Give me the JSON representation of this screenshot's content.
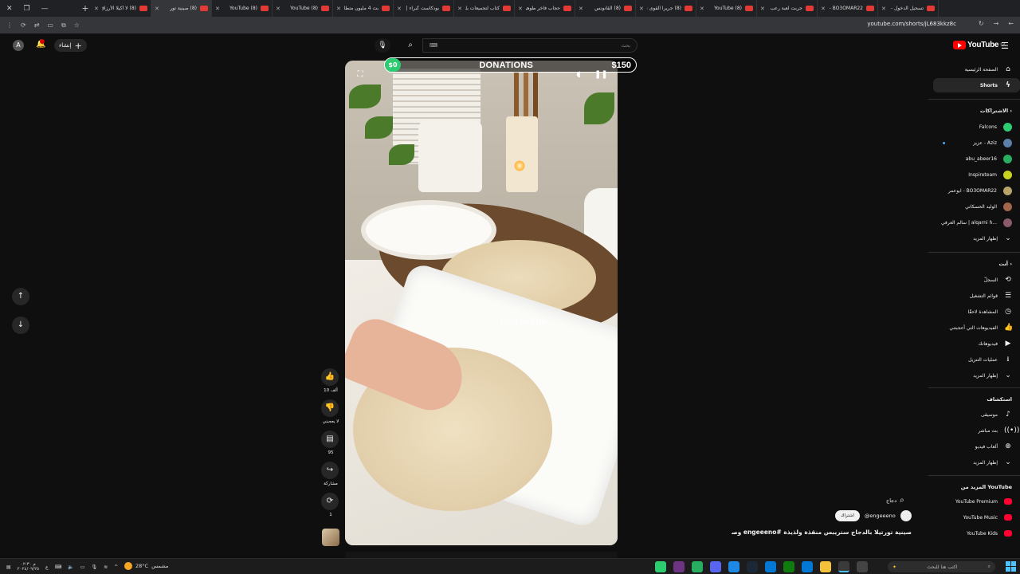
{
  "browser": {
    "tabs": [
      {
        "title": "(8) لا أكيلا الأرزاق جا",
        "active": false
      },
      {
        "title": "(8) صينية تور",
        "active": true
      },
      {
        "title": "(8) YouTube",
        "active": false
      },
      {
        "title": "(8) YouTube",
        "active": false
      },
      {
        "title": "بث 4 مليون متطا",
        "active": false
      },
      {
        "title": "بودكاست كُبراء |",
        "active": false
      },
      {
        "title": "كتاب لتجميعات بلد",
        "active": false
      },
      {
        "title": "حجاب فاخر طوهر",
        "active": false
      },
      {
        "title": "(8) القانونس",
        "active": false
      },
      {
        "title": "(8) جريرا القوى نادر",
        "active": false
      },
      {
        "title": "(8) YouTube",
        "active": false
      },
      {
        "title": "جربت لعبة رعب ...",
        "active": false
      },
      {
        "title": "BO3OMAR22 -",
        "active": false
      },
      {
        "title": "تسجيل الدخول -",
        "active": false
      }
    ],
    "url": "youtube.com/shorts/jL683kkz8c"
  },
  "topbar": {
    "avatar_letter": "A",
    "create_label": "إنشاء",
    "search_placeholder": "بحث",
    "keyboard_icon_label": "⌨",
    "logo_text": "YouTube",
    "logo_country": "SA"
  },
  "sidebar": {
    "home": "الصفحة الرئيسية",
    "shorts": "Shorts",
    "subscriptions_heading": "الاشتراكات",
    "channels": [
      {
        "name": "Falcons",
        "color": "#2ecc71"
      },
      {
        "name": "عزيز - Aziz",
        "color": "#5b7fa6"
      },
      {
        "name": "abu_abeer16",
        "color": "#27ae60"
      },
      {
        "name": "Inspireteam",
        "color": "#c9d21f"
      },
      {
        "name": "ابوعمر - BO3OMAR22",
        "color": "#b8a36a"
      },
      {
        "name": "الوليد الحسكاني",
        "color": "#a0654a"
      },
      {
        "name": "سالم العرفي | alqarni h...",
        "color": "#8a5a6a"
      }
    ],
    "show_more_1": "إظهار المزيد",
    "you_heading": "أنت",
    "you_items": [
      {
        "label": "السجلّ",
        "icon": "history-icon",
        "glyph": "⟲"
      },
      {
        "label": "قوائم التشغيل",
        "icon": "playlist-icon",
        "glyph": "☰"
      },
      {
        "label": "المشاهدة لاحقًا",
        "icon": "clock-icon",
        "glyph": "◷"
      },
      {
        "label": "الفيديوهات التي أعجبتني",
        "icon": "thumb-up-icon",
        "glyph": "👍"
      },
      {
        "label": "فيديوهاتك",
        "icon": "video-icon",
        "glyph": "▶"
      },
      {
        "label": "عمليات التنزيل",
        "icon": "download-icon",
        "glyph": "⭳"
      }
    ],
    "show_more_2": "إظهار المزيد",
    "explore_heading": "استكشاف",
    "explore_items": [
      {
        "label": "موسيقى",
        "icon": "music-icon",
        "glyph": "♪"
      },
      {
        "label": "بث مباشر",
        "icon": "live-icon",
        "glyph": "((•))"
      },
      {
        "label": "ألعاب فيديو",
        "icon": "gaming-icon",
        "glyph": "⊕"
      }
    ],
    "show_more_3": "إظهار المزيد",
    "more_from_heading": "المزيد من YouTube",
    "more_items": [
      {
        "label": "YouTube Premium",
        "color": "#ff0033"
      },
      {
        "label": "YouTube Music",
        "color": "#ff0033"
      },
      {
        "label": "YouTube Kids",
        "color": "#ff0033"
      }
    ]
  },
  "player": {
    "donations_title": "DONATIONS",
    "donations_left": "$0",
    "donations_right": "$150",
    "watermark": "Engeeeno"
  },
  "actions": {
    "like_count": "10 ألف",
    "dislike_label": "لا يعجبني",
    "comment_count": "95",
    "share_label": "مشاركة",
    "remix_count": "1"
  },
  "info": {
    "search_tag": "دجاج",
    "subscribe_label": "اشتراك",
    "channel_handle": "@engeeeno",
    "title": "صينية تورتيلا بالدجاج ستريبس منقذة ولذيذة #engeeeno وصفا..."
  },
  "taskbar": {
    "time": "م ٠٢:٣٠",
    "date": "٢٠٢٤/٠٩/٢٥",
    "weather_temp": "28°C",
    "weather_label": "مشمس",
    "search_placeholder": "اكتب هنا للبحث"
  }
}
